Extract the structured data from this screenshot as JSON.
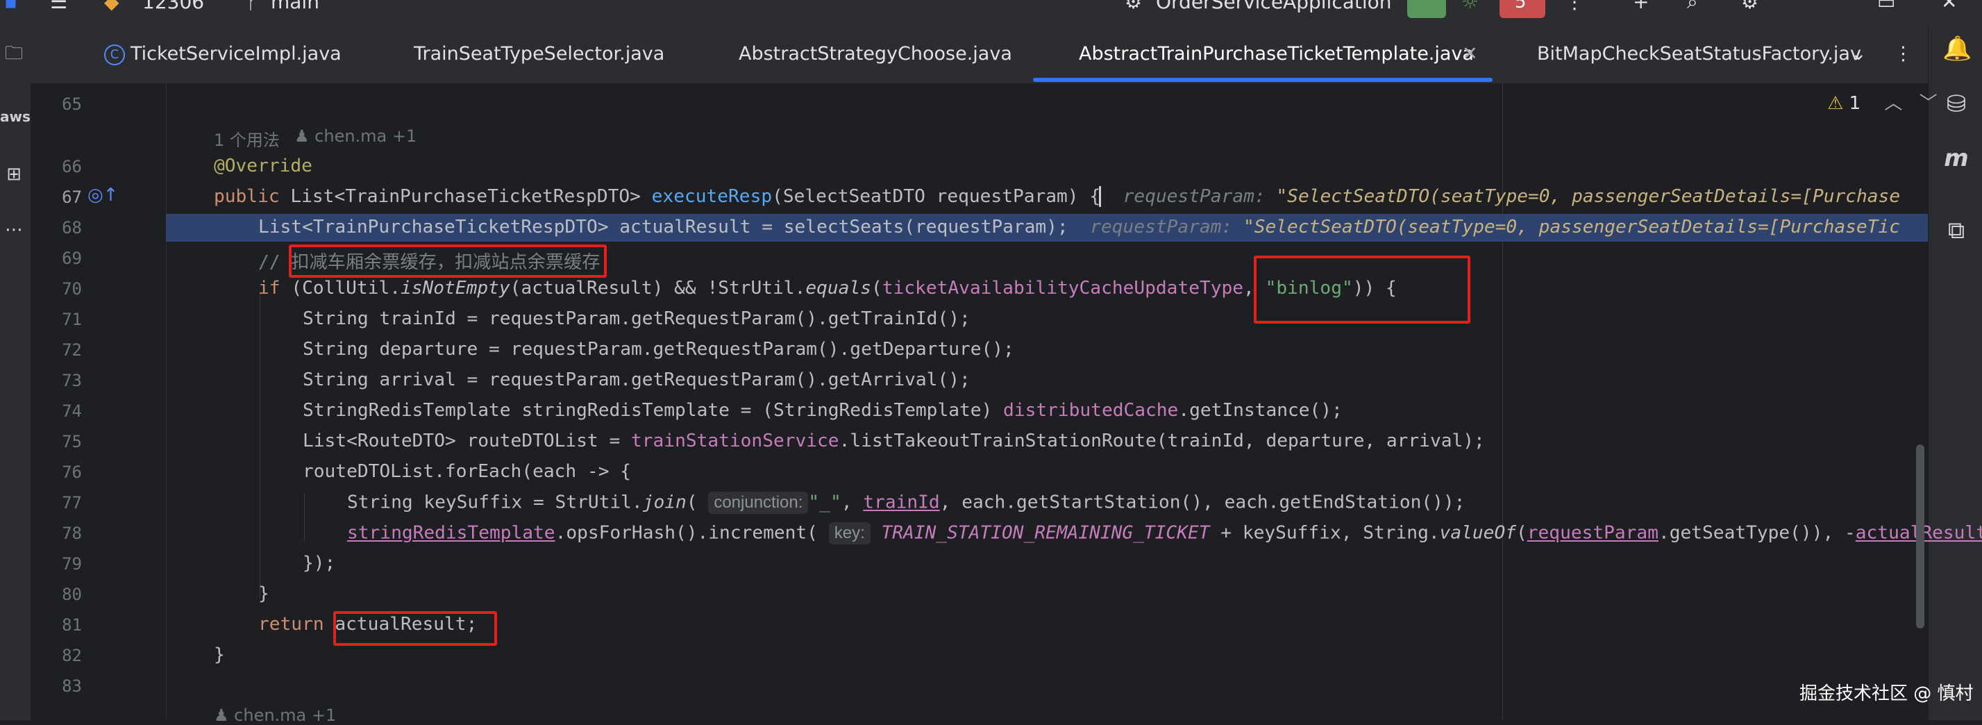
{
  "titlebar": {
    "project": "12306",
    "branch": "main",
    "run_config": "OrderServiceApplication",
    "notification_count": "5"
  },
  "tabs": [
    {
      "label": "TicketServiceImpl.java",
      "active": false
    },
    {
      "label": "TrainSeatTypeSelector.java",
      "active": false
    },
    {
      "label": "AbstractStrategyChoose.java",
      "active": false
    },
    {
      "label": "AbstractTrainPurchaseTicketTemplate.java",
      "active": true
    },
    {
      "label": "BitMapCheckSeatStatusFactory.jav",
      "active": false
    }
  ],
  "editor": {
    "warning_count": "1",
    "usages": "1 个用法",
    "author": "chen.ma +1",
    "line_numbers": [
      "65",
      "66",
      "67",
      "68",
      "69",
      "70",
      "71",
      "72",
      "73",
      "74",
      "75",
      "76",
      "77",
      "78",
      "79",
      "80",
      "81",
      "82",
      "83"
    ],
    "current_line": "67",
    "comment_text": "扣减车厢余票缓存，扣减站点余票缓存",
    "hint_request_param_label": "requestParam:",
    "hint_request_param_value": "\"SelectSeatDTO(seatType=0, passengerSeatDetails=[Purchase",
    "hint_request_param_value_2": "\"SelectSeatDTO(seatType=0, passengerSeatDetails=[PurchaseTic",
    "binlog_string": "\"binlog\"",
    "inlay_conjunction": "conjunction:",
    "inlay_key": "key:",
    "underscore_string": "\"_\"",
    "constant_name": "TRAIN_STATION_REMAINING_TICKET"
  },
  "watermark": "掘金技术社区 @ 慎村",
  "colors": {
    "selection": "#2e436e",
    "highlight_box": "#e3201b",
    "tab_underline": "#3574f0"
  }
}
